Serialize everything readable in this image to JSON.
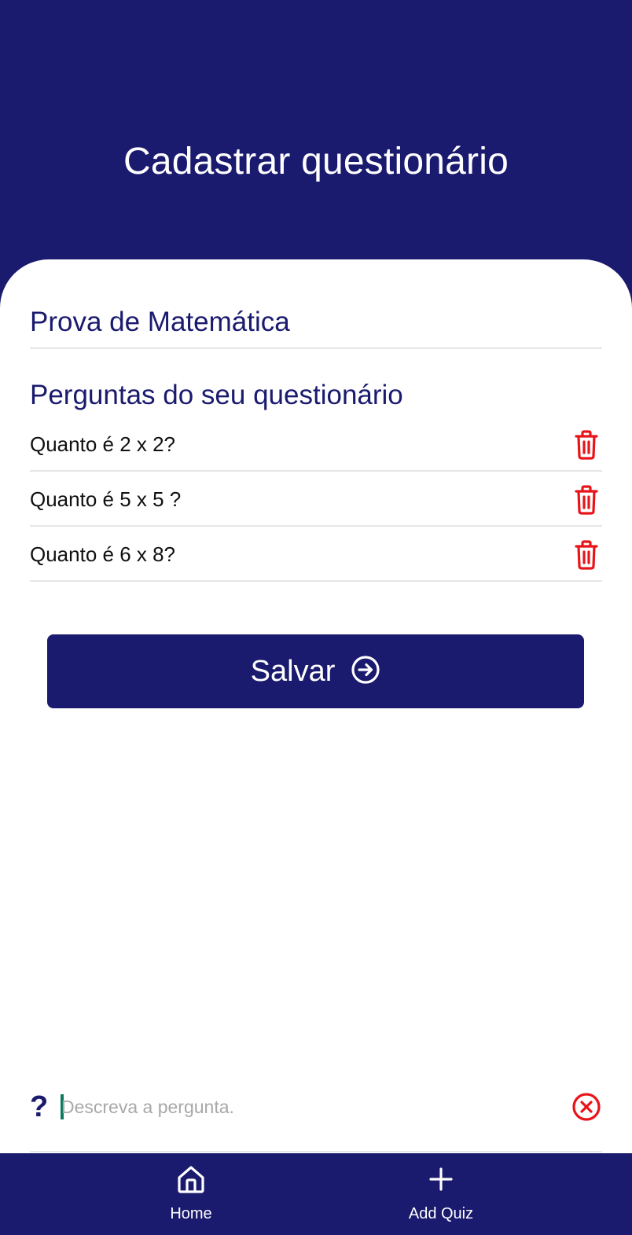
{
  "header": {
    "title": "Cadastrar questionário"
  },
  "quiz": {
    "name": "Prova de Matemática"
  },
  "questions_section": {
    "title": "Perguntas do seu questionário",
    "items": [
      {
        "text": "Quanto é 2 x 2?",
        "icon": "trash-icon"
      },
      {
        "text": "Quanto é 5 x 5 ?",
        "icon": "trash-icon"
      },
      {
        "text": "Quanto é 6 x 8?",
        "icon": "trash-icon"
      }
    ]
  },
  "save_button": {
    "label": "Salvar",
    "icon": "arrow-circle-right-icon"
  },
  "question_input": {
    "placeholder": "Descreva a pergunta.",
    "value": "",
    "leading_icon": "question-mark-icon",
    "trailing_icon": "clear-circle-icon"
  },
  "bottom_nav": {
    "items": [
      {
        "label": "Home",
        "icon": "home-icon"
      },
      {
        "label": "Add Quiz",
        "icon": "plus-icon"
      }
    ]
  },
  "colors": {
    "primary": "#1a1a6e",
    "danger": "#e8141a",
    "divider": "#e6e6e6",
    "caret": "#0d7a5f"
  }
}
